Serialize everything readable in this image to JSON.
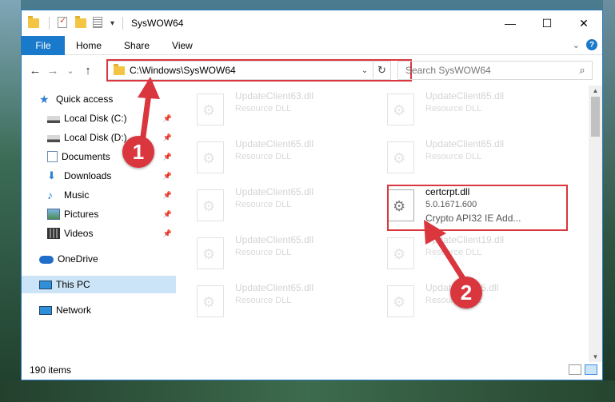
{
  "window": {
    "title": "SysWOW64"
  },
  "ribbon": {
    "tabs": [
      "File",
      "Home",
      "Share",
      "View"
    ]
  },
  "window_buttons": {
    "minimize": "—",
    "maximize": "☐",
    "close": "✕"
  },
  "nav": {
    "back": "←",
    "forward": "→",
    "recent": "⌄",
    "up": "↑",
    "address": "C:\\Windows\\SysWOW64",
    "address_dropdown": "⌄",
    "refresh": "↻",
    "search_placeholder": "Search SysWOW64",
    "search_icon": "⌕"
  },
  "sidebar": {
    "items": [
      {
        "label": "Quick access",
        "icon": "star-icon",
        "pinned": false
      },
      {
        "label": "Local Disk (C:)",
        "icon": "drive-icon",
        "pinned": true
      },
      {
        "label": "Local Disk (D:)",
        "icon": "drive-icon",
        "pinned": true
      },
      {
        "label": "Documents",
        "icon": "documents-icon",
        "pinned": true
      },
      {
        "label": "Downloads",
        "icon": "downloads-icon",
        "pinned": true
      },
      {
        "label": "Music",
        "icon": "music-icon",
        "pinned": true
      },
      {
        "label": "Pictures",
        "icon": "pictures-icon",
        "pinned": true
      },
      {
        "label": "Videos",
        "icon": "videos-icon",
        "pinned": true
      },
      {
        "label": "OneDrive",
        "icon": "cloud-icon",
        "pinned": false
      },
      {
        "label": "This PC",
        "icon": "computer-icon",
        "pinned": false,
        "selected": true
      },
      {
        "label": "Network",
        "icon": "network-icon",
        "pinned": false
      }
    ]
  },
  "files": [
    {
      "name": "UpdateClient63.dll",
      "type": "Resource DLL"
    },
    {
      "name": "UpdateClient65.dll",
      "type": "Resource DLL"
    },
    {
      "name": "UpdateClient65.dll",
      "type": "Resource DLL"
    },
    {
      "name": "UpdateClient65.dll",
      "type": "Resource DLL"
    },
    {
      "name": "UpdateClient65.dll",
      "type": "Resource DLL"
    },
    {
      "name": "certcrpt.dll",
      "type": "5.0.1671.600",
      "desc": "Crypto API32 IE Add..."
    },
    {
      "name": "UpdateClient65.dll",
      "type": "Resource DLL"
    },
    {
      "name": "UpdateClient19.dll",
      "type": "Resource DLL"
    },
    {
      "name": "UpdateClient65.dll",
      "type": "Resource DLL"
    },
    {
      "name": "UpdateClient5.dll",
      "type": "Resource DLL"
    }
  ],
  "status": {
    "item_count": "190 items"
  },
  "annotations": {
    "step1": "1",
    "step2": "2",
    "color": "#d9363e"
  },
  "colors": {
    "accent": "#1979ca",
    "selection": "#cce4f7",
    "highlight": "#d9363e"
  }
}
